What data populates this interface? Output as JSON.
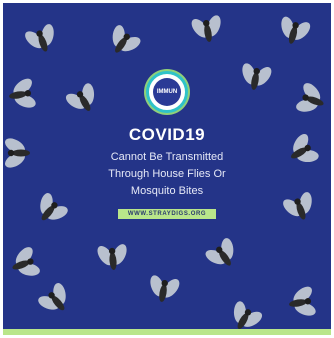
{
  "poster": {
    "background_color": "#243488",
    "accent_color": "#b9e68a",
    "logo_text": "IMMUN",
    "headline": "COVID19",
    "subtitle_lines": [
      "Cannot Be Transmitted",
      "Through House Flies Or",
      "Mosquito Bites"
    ],
    "cta_label": "WWW.STRAYDIGS.ORG"
  }
}
